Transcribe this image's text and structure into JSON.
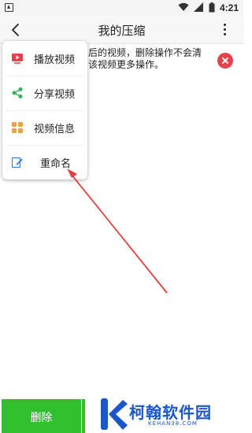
{
  "status_bar": {
    "time": "4:21",
    "icons": [
      "app-icon",
      "wifi-icon",
      "signal-icon",
      "battery-icon"
    ]
  },
  "title_bar": {
    "title": "我的压缩",
    "back_icon": "chevron-left-icon",
    "more_icon": "more-vertical-icon"
  },
  "notice": {
    "text": "后的视频，删除操作不会清\n该视频更多操作。",
    "close_icon": "close-icon",
    "close_color": "#e5424d"
  },
  "popup_menu": {
    "items": [
      {
        "label": "播放视频",
        "icon": "play-video-icon",
        "color": "#e5424d"
      },
      {
        "label": "分享视频",
        "icon": "share-icon",
        "color": "#2fb45a"
      },
      {
        "label": "视频信息",
        "icon": "info-grid-icon",
        "color": "#f0a03c"
      },
      {
        "label": "重命名",
        "icon": "edit-icon",
        "color": "#3b7de0"
      }
    ]
  },
  "bottom_bar": {
    "delete_label": "删除",
    "delete_color": "#2fbf2f"
  },
  "watermark": {
    "text": "柯翰软件园",
    "url": "KEHAN38.COM",
    "color": "#1b57c8"
  },
  "annotation": {
    "arrow_color": "#e04040"
  }
}
